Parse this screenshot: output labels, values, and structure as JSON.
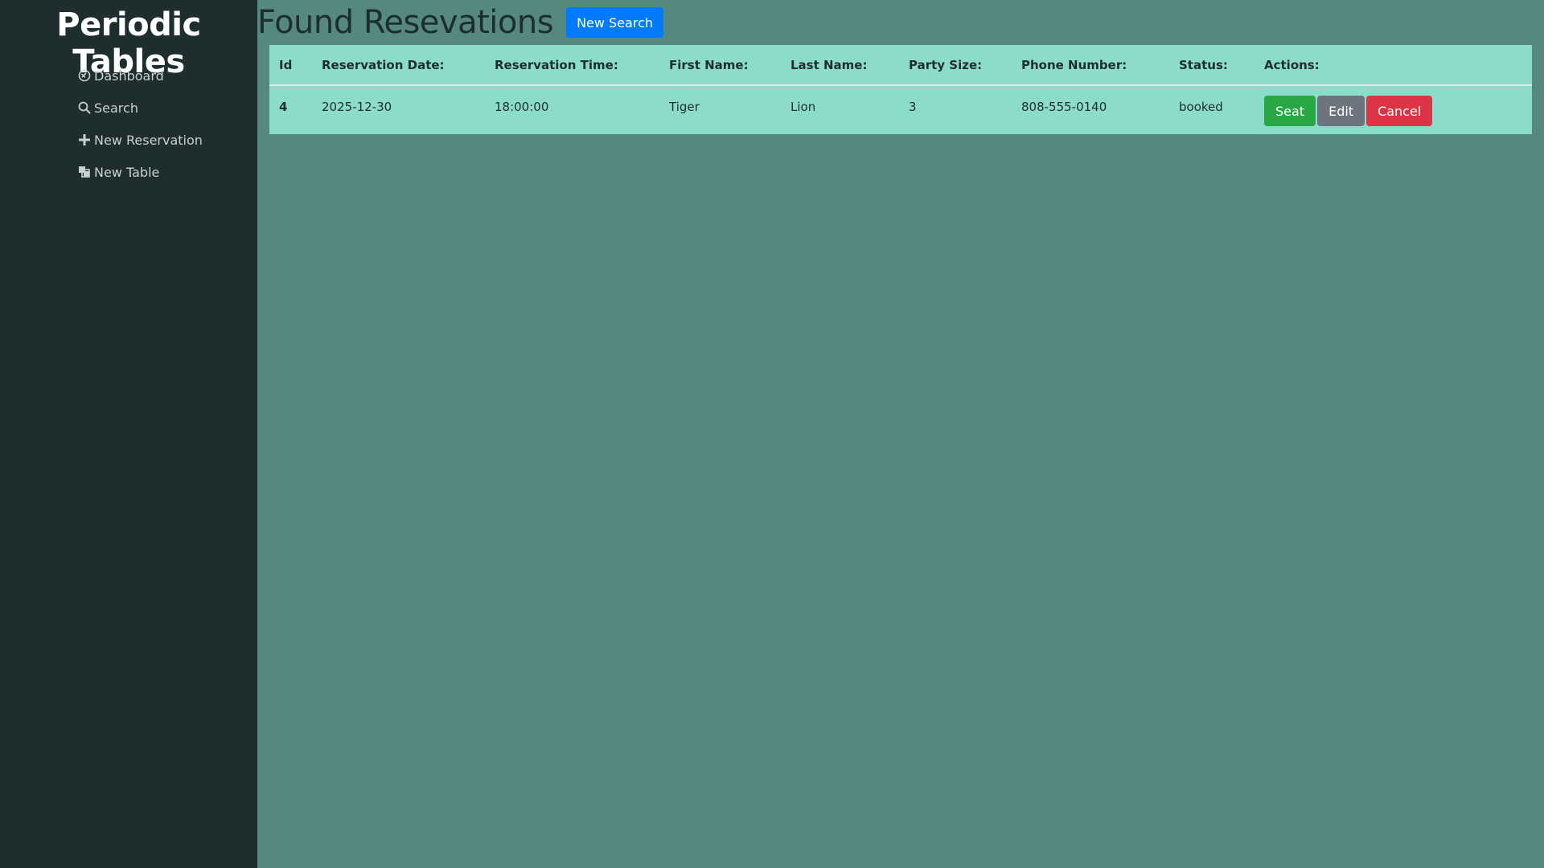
{
  "sidebar": {
    "brand": "Periodic Tables",
    "items": [
      {
        "label": "Dashboard",
        "icon": "dashboard-icon"
      },
      {
        "label": "Search",
        "icon": "search-icon"
      },
      {
        "label": "New Reservation",
        "icon": "plus-icon"
      },
      {
        "label": "New Table",
        "icon": "layers-icon"
      }
    ]
  },
  "header": {
    "title": "Found Resevations",
    "new_search_label": "New Search"
  },
  "table": {
    "columns": [
      "Id",
      "Reservation Date:",
      "Reservation Time:",
      "First Name:",
      "Last Name:",
      "Party Size:",
      "Phone Number:",
      "Status:",
      "Actions:"
    ],
    "rows": [
      {
        "id": "4",
        "date": "2025-12-30",
        "time": "18:00:00",
        "first_name": "Tiger",
        "last_name": "Lion",
        "party_size": "3",
        "phone": "808-555-0140",
        "status": "booked",
        "actions": {
          "seat": "Seat",
          "edit": "Edit",
          "cancel": "Cancel"
        }
      }
    ]
  },
  "colors": {
    "sidebar_bg": "#1e2e2e",
    "main_bg": "#558880",
    "table_bg": "#8cdccc",
    "primary": "#007bff",
    "success": "#28a745",
    "secondary": "#6c757d",
    "danger": "#dc3545"
  }
}
